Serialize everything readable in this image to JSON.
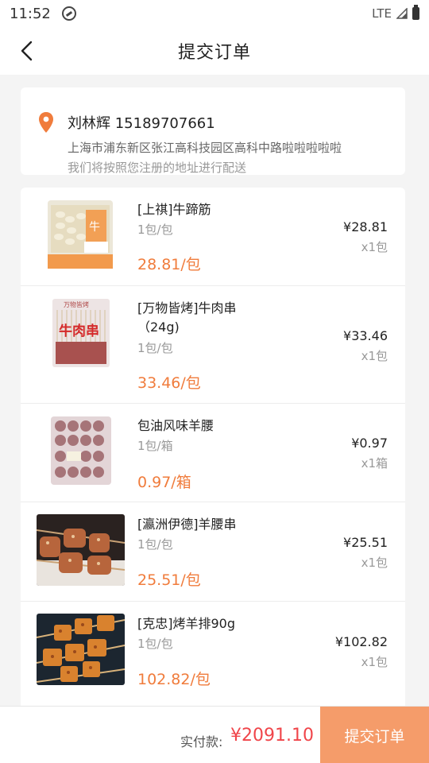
{
  "status_bar": {
    "time": "11:52",
    "network": "LTE"
  },
  "nav": {
    "title": "提交订单"
  },
  "address": {
    "name_phone": "刘林辉 15189707661",
    "detail": "上海市浦东新区张江高科技园区高科中路啦啦啦啦啦",
    "note": "我们将按照您注册的地址进行配送"
  },
  "goods": [
    {
      "name": "[上祺]牛蹄筋",
      "spec": "1包/包",
      "unit_price": "28.81/包",
      "price": "¥28.81",
      "qty": "x1包"
    },
    {
      "name": "[万物皆烤]牛肉串（24g)",
      "spec": "1包/包",
      "unit_price": "33.46/包",
      "price": "¥33.46",
      "qty": "x1包"
    },
    {
      "name": "包油风味羊腰",
      "spec": "1包/箱",
      "unit_price": "0.97/箱",
      "price": "¥0.97",
      "qty": "x1箱"
    },
    {
      "name": "[瀛洲伊德]羊腰串",
      "spec": "1包/包",
      "unit_price": "25.51/包",
      "price": "¥25.51",
      "qty": "x1包"
    },
    {
      "name": "[克忠]烤羊排90g",
      "spec": "1包/包",
      "unit_price": "102.82/包",
      "price": "¥102.82",
      "qty": "x1包"
    }
  ],
  "bottom": {
    "paid_label": "实付款:",
    "paid_amount": "¥2091.10",
    "submit_label": "提交订单"
  },
  "colors": {
    "accent_orange": "#f07c3c",
    "price_red": "#f0454a",
    "submit_bg": "#f59c6a"
  }
}
